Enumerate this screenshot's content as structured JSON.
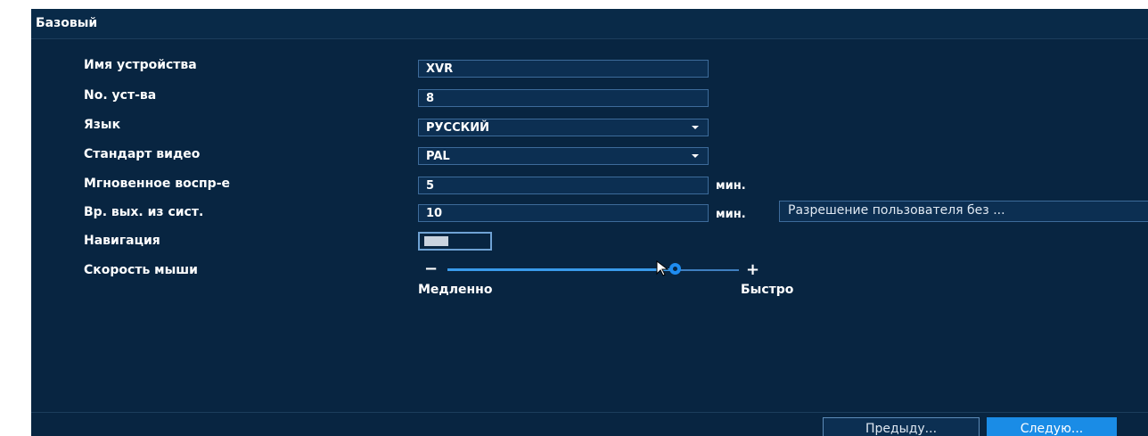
{
  "window": {
    "title": "Базовый"
  },
  "form": {
    "device_name": {
      "label": "Имя устройства",
      "value": "XVR"
    },
    "device_no": {
      "label": "No. уст-ва",
      "value": "8"
    },
    "language": {
      "label": "Язык",
      "value": "РУССКИЙ"
    },
    "video_standard": {
      "label": "Стандарт видео",
      "value": "PAL"
    },
    "instant_playback": {
      "label": "Мгновенное воспр-е",
      "value": "5",
      "unit": "мин."
    },
    "logout_time": {
      "label": "Вр. вых. из сист.",
      "value": "10",
      "unit": "мин.",
      "permission_button": "Разрешение пользователя без ..."
    },
    "navigation": {
      "label": "Навигация",
      "toggle_on": false
    },
    "mouse_speed": {
      "label": "Скорость мыши",
      "minus": "−",
      "plus": "+",
      "slow_label": "Медленно",
      "fast_label": "Быстро",
      "level_fraction": 0.78
    }
  },
  "footer": {
    "prev_button": "Предыду...",
    "next_button": "Следую..."
  },
  "colors": {
    "background": "#082541",
    "field_border": "#3d6b9a",
    "accent": "#1a8ce6",
    "slider": "#3a9bea"
  },
  "icons": {
    "language_dropdown": "chevron-down-icon",
    "video_dropdown": "chevron-down-icon",
    "cursor": "mouse-pointer-icon"
  }
}
